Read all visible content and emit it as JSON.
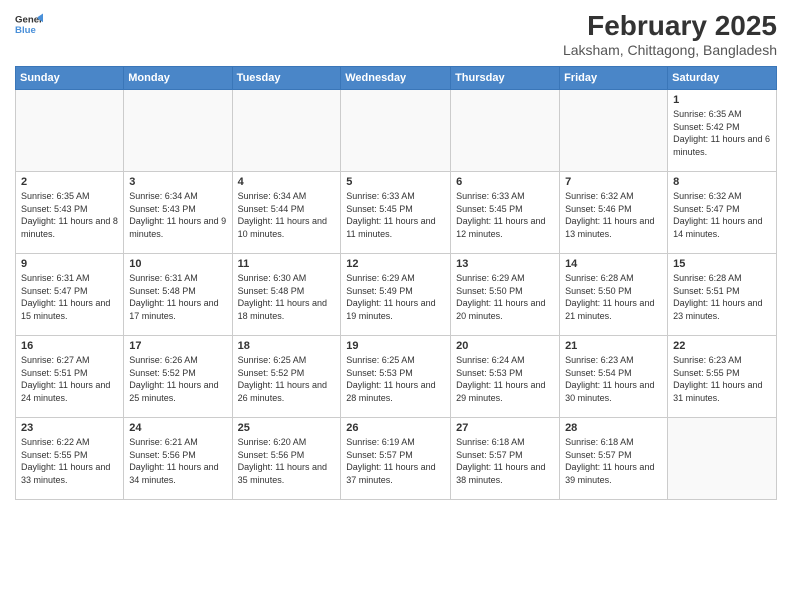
{
  "logo": {
    "line1": "General",
    "line2": "Blue"
  },
  "title": "February 2025",
  "subtitle": "Laksham, Chittagong, Bangladesh",
  "days_of_week": [
    "Sunday",
    "Monday",
    "Tuesday",
    "Wednesday",
    "Thursday",
    "Friday",
    "Saturday"
  ],
  "weeks": [
    [
      {
        "day": "",
        "info": ""
      },
      {
        "day": "",
        "info": ""
      },
      {
        "day": "",
        "info": ""
      },
      {
        "day": "",
        "info": ""
      },
      {
        "day": "",
        "info": ""
      },
      {
        "day": "",
        "info": ""
      },
      {
        "day": "1",
        "info": "Sunrise: 6:35 AM\nSunset: 5:42 PM\nDaylight: 11 hours and 6 minutes."
      }
    ],
    [
      {
        "day": "2",
        "info": "Sunrise: 6:35 AM\nSunset: 5:43 PM\nDaylight: 11 hours and 8 minutes."
      },
      {
        "day": "3",
        "info": "Sunrise: 6:34 AM\nSunset: 5:43 PM\nDaylight: 11 hours and 9 minutes."
      },
      {
        "day": "4",
        "info": "Sunrise: 6:34 AM\nSunset: 5:44 PM\nDaylight: 11 hours and 10 minutes."
      },
      {
        "day": "5",
        "info": "Sunrise: 6:33 AM\nSunset: 5:45 PM\nDaylight: 11 hours and 11 minutes."
      },
      {
        "day": "6",
        "info": "Sunrise: 6:33 AM\nSunset: 5:45 PM\nDaylight: 11 hours and 12 minutes."
      },
      {
        "day": "7",
        "info": "Sunrise: 6:32 AM\nSunset: 5:46 PM\nDaylight: 11 hours and 13 minutes."
      },
      {
        "day": "8",
        "info": "Sunrise: 6:32 AM\nSunset: 5:47 PM\nDaylight: 11 hours and 14 minutes."
      }
    ],
    [
      {
        "day": "9",
        "info": "Sunrise: 6:31 AM\nSunset: 5:47 PM\nDaylight: 11 hours and 15 minutes."
      },
      {
        "day": "10",
        "info": "Sunrise: 6:31 AM\nSunset: 5:48 PM\nDaylight: 11 hours and 17 minutes."
      },
      {
        "day": "11",
        "info": "Sunrise: 6:30 AM\nSunset: 5:48 PM\nDaylight: 11 hours and 18 minutes."
      },
      {
        "day": "12",
        "info": "Sunrise: 6:29 AM\nSunset: 5:49 PM\nDaylight: 11 hours and 19 minutes."
      },
      {
        "day": "13",
        "info": "Sunrise: 6:29 AM\nSunset: 5:50 PM\nDaylight: 11 hours and 20 minutes."
      },
      {
        "day": "14",
        "info": "Sunrise: 6:28 AM\nSunset: 5:50 PM\nDaylight: 11 hours and 21 minutes."
      },
      {
        "day": "15",
        "info": "Sunrise: 6:28 AM\nSunset: 5:51 PM\nDaylight: 11 hours and 23 minutes."
      }
    ],
    [
      {
        "day": "16",
        "info": "Sunrise: 6:27 AM\nSunset: 5:51 PM\nDaylight: 11 hours and 24 minutes."
      },
      {
        "day": "17",
        "info": "Sunrise: 6:26 AM\nSunset: 5:52 PM\nDaylight: 11 hours and 25 minutes."
      },
      {
        "day": "18",
        "info": "Sunrise: 6:25 AM\nSunset: 5:52 PM\nDaylight: 11 hours and 26 minutes."
      },
      {
        "day": "19",
        "info": "Sunrise: 6:25 AM\nSunset: 5:53 PM\nDaylight: 11 hours and 28 minutes."
      },
      {
        "day": "20",
        "info": "Sunrise: 6:24 AM\nSunset: 5:53 PM\nDaylight: 11 hours and 29 minutes."
      },
      {
        "day": "21",
        "info": "Sunrise: 6:23 AM\nSunset: 5:54 PM\nDaylight: 11 hours and 30 minutes."
      },
      {
        "day": "22",
        "info": "Sunrise: 6:23 AM\nSunset: 5:55 PM\nDaylight: 11 hours and 31 minutes."
      }
    ],
    [
      {
        "day": "23",
        "info": "Sunrise: 6:22 AM\nSunset: 5:55 PM\nDaylight: 11 hours and 33 minutes."
      },
      {
        "day": "24",
        "info": "Sunrise: 6:21 AM\nSunset: 5:56 PM\nDaylight: 11 hours and 34 minutes."
      },
      {
        "day": "25",
        "info": "Sunrise: 6:20 AM\nSunset: 5:56 PM\nDaylight: 11 hours and 35 minutes."
      },
      {
        "day": "26",
        "info": "Sunrise: 6:19 AM\nSunset: 5:57 PM\nDaylight: 11 hours and 37 minutes."
      },
      {
        "day": "27",
        "info": "Sunrise: 6:18 AM\nSunset: 5:57 PM\nDaylight: 11 hours and 38 minutes."
      },
      {
        "day": "28",
        "info": "Sunrise: 6:18 AM\nSunset: 5:57 PM\nDaylight: 11 hours and 39 minutes."
      },
      {
        "day": "",
        "info": ""
      }
    ]
  ]
}
